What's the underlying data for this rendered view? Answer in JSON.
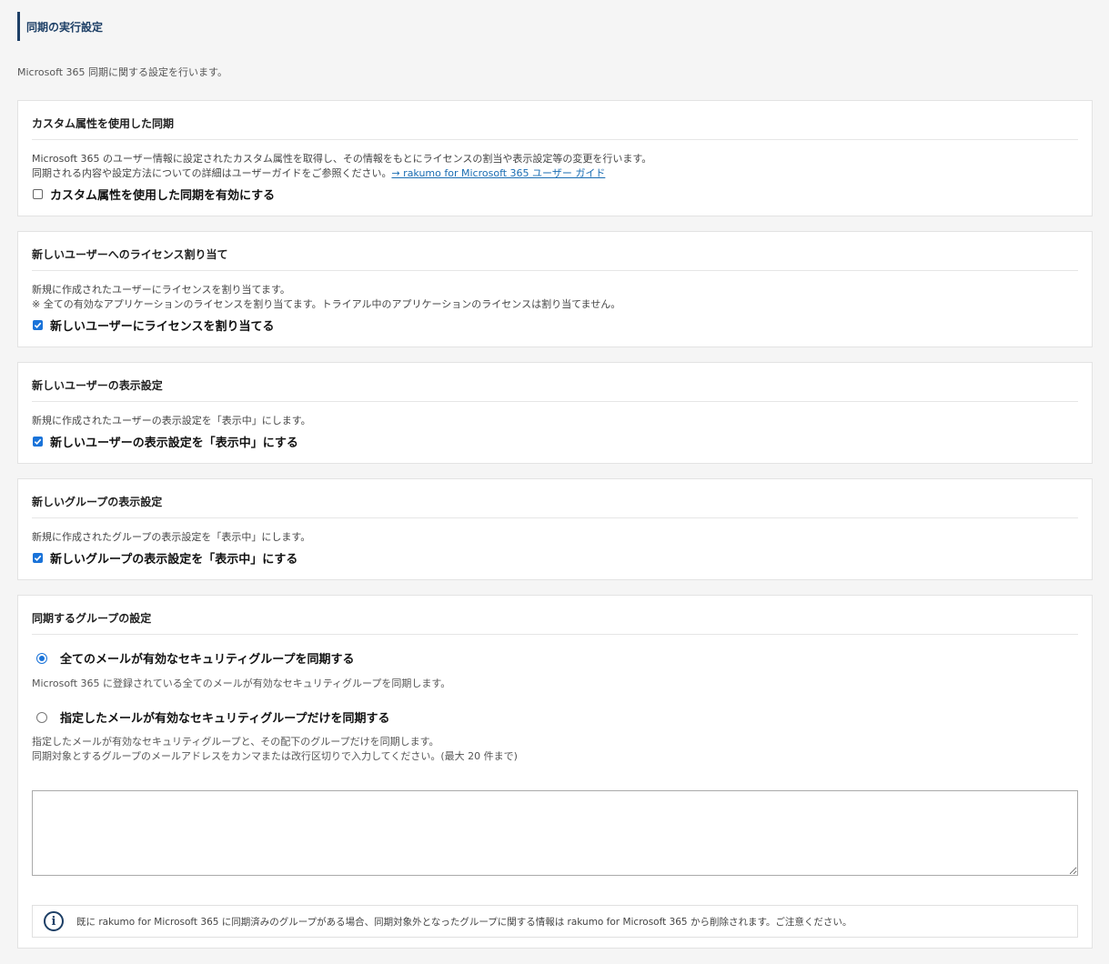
{
  "page": {
    "title": "同期の実行設定",
    "description": "Microsoft 365 同期に関する設定を行います。"
  },
  "custom_attr": {
    "heading": "カスタム属性を使用した同期",
    "desc_line1": "Microsoft 365 のユーザー情報に設定されたカスタム属性を取得し、その情報をもとにライセンスの割当や表示設定等の変更を行います。",
    "desc_line2": "同期される内容や設定方法についての詳細はユーザーガイドをご参照ください。",
    "guide_link": "→ rakumo for Microsoft 365 ユーザー ガイド",
    "checkbox_label": "カスタム属性を使用した同期を有効にする",
    "checked": false
  },
  "license": {
    "heading": "新しいユーザーへのライセンス割り当て",
    "desc_line1": "新規に作成されたユーザーにライセンスを割り当てます。",
    "desc_line2": "※ 全ての有効なアプリケーションのライセンスを割り当てます。トライアル中のアプリケーションのライセンスは割り当てません。",
    "checkbox_label": "新しいユーザーにライセンスを割り当てる",
    "checked": true
  },
  "user_display": {
    "heading": "新しいユーザーの表示設定",
    "desc_line1": "新規に作成されたユーザーの表示設定を「表示中」にします。",
    "checkbox_label": "新しいユーザーの表示設定を「表示中」にする",
    "checked": true
  },
  "group_display": {
    "heading": "新しいグループの表示設定",
    "desc_line1": "新規に作成されたグループの表示設定を「表示中」にします。",
    "checkbox_label": "新しいグループの表示設定を「表示中」にする",
    "checked": true
  },
  "sync_groups": {
    "heading": "同期するグループの設定",
    "option_all_label": "全てのメールが有効なセキュリティグループを同期する",
    "option_all_desc": "Microsoft 365 に登録されている全てのメールが有効なセキュリティグループを同期します。",
    "option_all_selected": true,
    "option_specified_label": "指定したメールが有効なセキュリティグループだけを同期する",
    "option_specified_desc1": "指定したメールが有効なセキュリティグループと、その配下のグループだけを同期します。",
    "option_specified_desc2": "同期対象とするグループのメールアドレスをカンマまたは改行区切りで入力してください。(最大 20 件まで)",
    "option_specified_selected": false,
    "textarea_value": "",
    "notice": "既に rakumo for Microsoft 365 に同期済みのグループがある場合、同期対象外となったグループに関する情報は rakumo for Microsoft 365 から削除されます。ご注意ください。",
    "notice_icon": "info-icon"
  },
  "colors": {
    "accent": "#1a73d9",
    "title_bar": "#1d3f66",
    "link": "#1a6db3"
  }
}
